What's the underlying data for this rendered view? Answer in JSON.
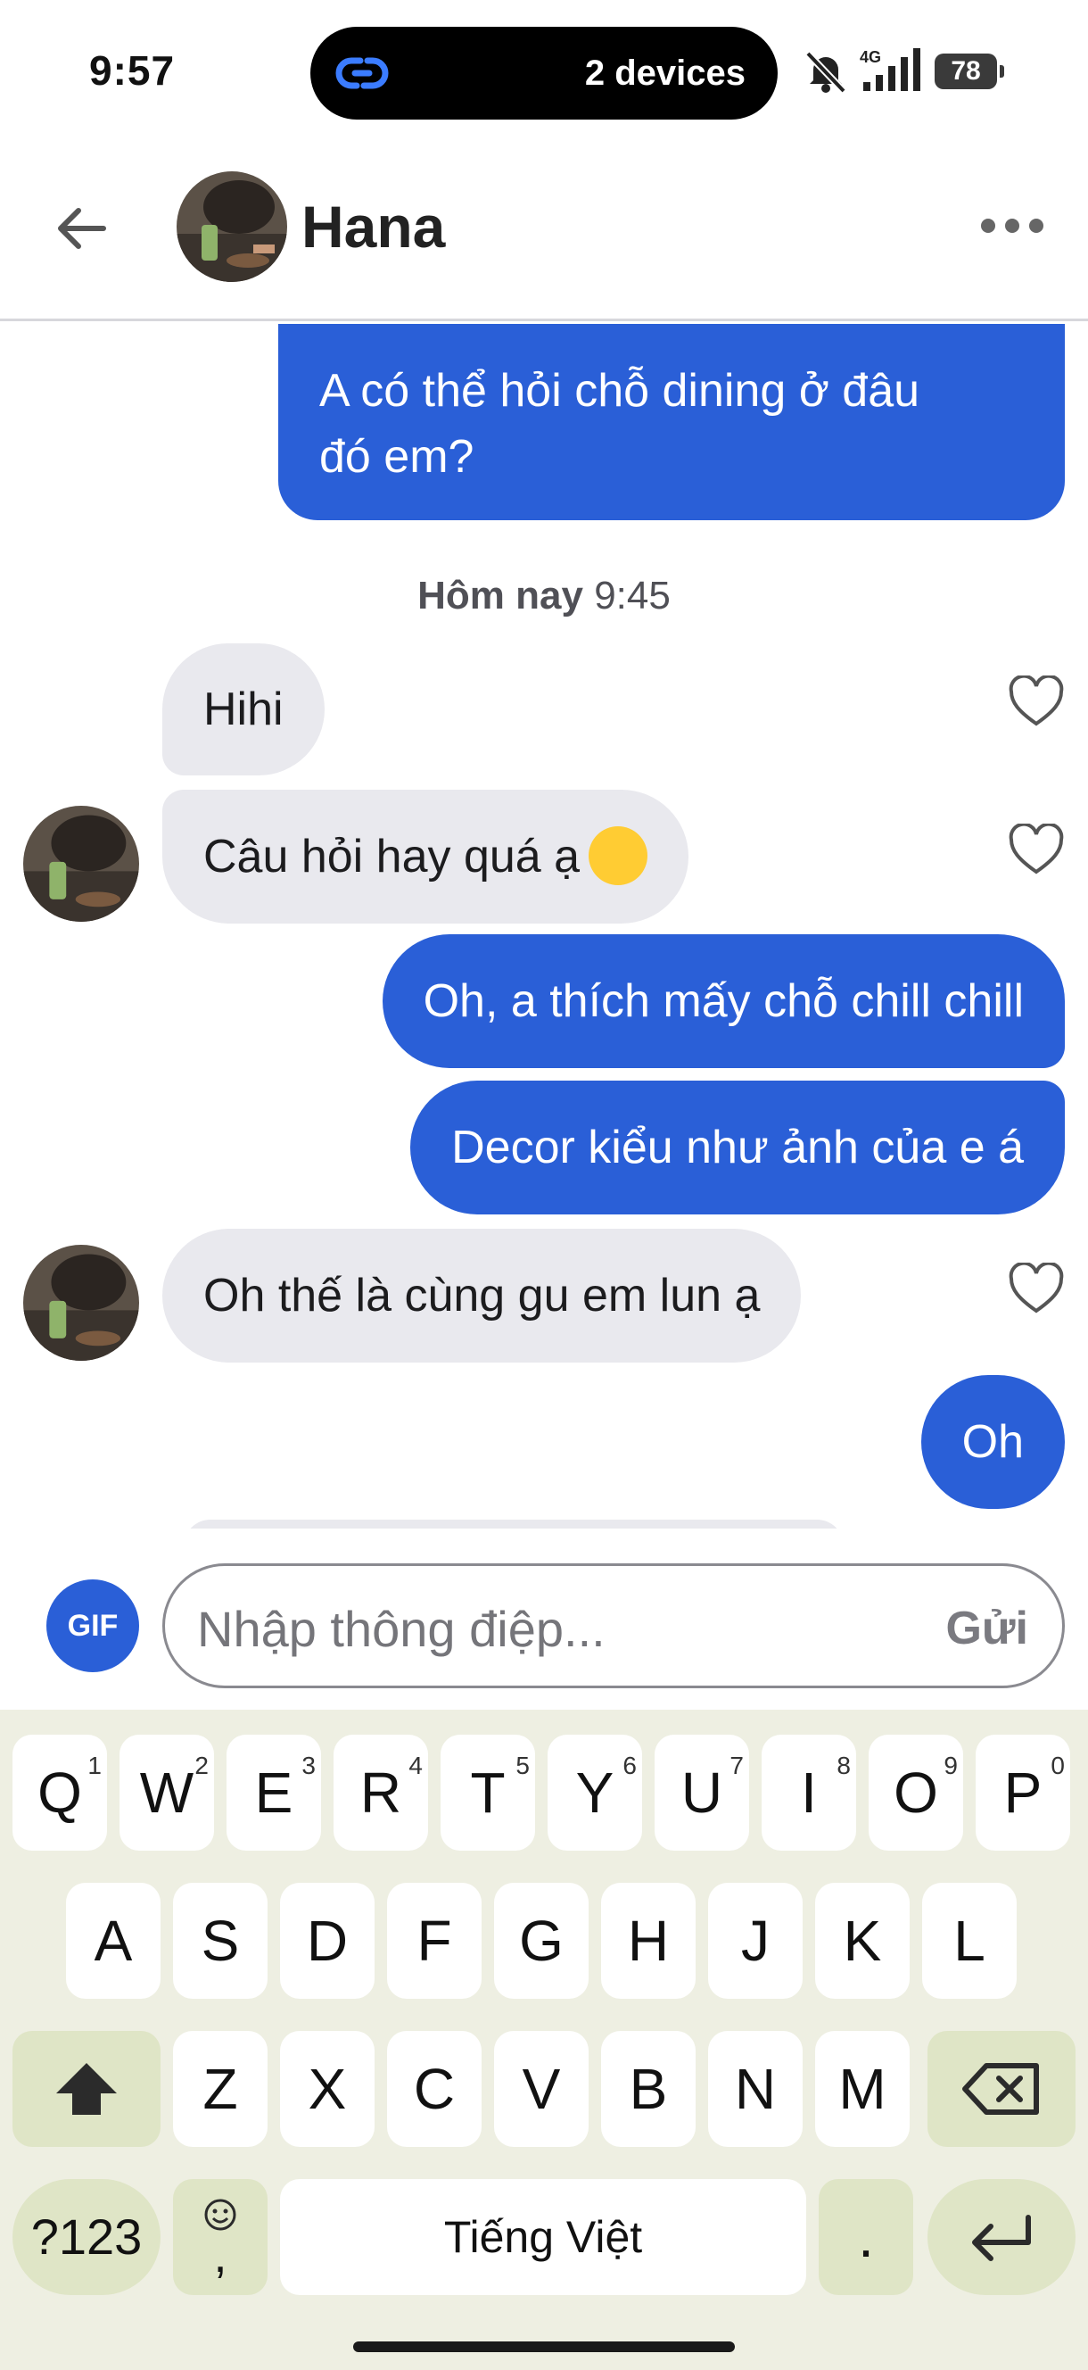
{
  "status_bar": {
    "time": "9:57",
    "island_text": "2 devices",
    "battery": "78",
    "network": "4G"
  },
  "header": {
    "contact_name": "Hana"
  },
  "chat": {
    "timestamp_day": "Hôm nay",
    "timestamp_time": "9:45",
    "messages": [
      {
        "direction": "out",
        "text_line1": "A có thể hỏi chỗ dining ở đâu",
        "text_line2": "đó em?"
      },
      {
        "direction": "in",
        "text": "Hihi"
      },
      {
        "direction": "in",
        "text": "Câu hỏi hay quá ạ"
      },
      {
        "direction": "out",
        "text": "Oh, a thích mấy chỗ chill chill"
      },
      {
        "direction": "out",
        "text": "Decor kiểu như ảnh của e á"
      },
      {
        "direction": "in",
        "text": "Oh thế là cùng gu em lun ạ"
      },
      {
        "direction": "out",
        "text": "Oh"
      }
    ]
  },
  "composer": {
    "gif_label": "GIF",
    "placeholder": "Nhập thông điệp...",
    "send_label": "Gửi"
  },
  "keyboard": {
    "row1": [
      "Q",
      "W",
      "E",
      "R",
      "T",
      "Y",
      "U",
      "I",
      "O",
      "P"
    ],
    "row1_hints": [
      "1",
      "2",
      "3",
      "4",
      "5",
      "6",
      "7",
      "8",
      "9",
      "0"
    ],
    "row2": [
      "A",
      "S",
      "D",
      "F",
      "G",
      "H",
      "J",
      "K",
      "L"
    ],
    "row3": [
      "Z",
      "X",
      "C",
      "V",
      "B",
      "N",
      "M"
    ],
    "symbols_label": "?123",
    "space_label": "Tiếng Việt",
    "period_label": ".",
    "comma_label": ","
  },
  "colors": {
    "outgoing_bubble": "#2a5fd7",
    "incoming_bubble": "#e9e9ee",
    "keyboard_bg": "#eeefe2",
    "function_key": "#dfe5c6"
  }
}
